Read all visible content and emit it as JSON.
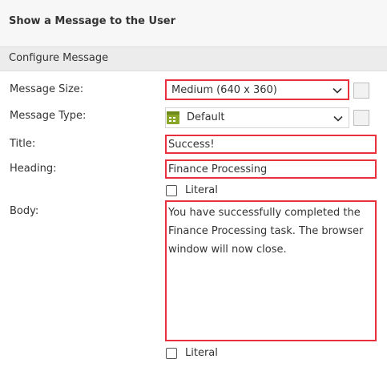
{
  "header": {
    "title": "Show a Message to the User"
  },
  "section": {
    "title": "Configure Message"
  },
  "form": {
    "message_size": {
      "label": "Message Size:",
      "value": "Medium (640 x 360)"
    },
    "message_type": {
      "label": "Message Type:",
      "value": "Default"
    },
    "title": {
      "label": "Title:",
      "value": "Success!"
    },
    "heading": {
      "label": "Heading:",
      "value": "Finance Processing",
      "literal_label": "Literal",
      "literal_checked": false
    },
    "body": {
      "label": "Body:",
      "value": "You have successfully completed the\nFinance Processing task. The browser\nwindow will now close.",
      "literal_label": "Literal",
      "literal_checked": false
    }
  },
  "colors": {
    "highlight_border": "#e8313d",
    "header_bg": "#f7f7f7",
    "section_bg": "#ececec",
    "type_icon": "#8aa629"
  },
  "icons": {
    "dropdown": "chevron-down-icon",
    "message_type": "grid-app-icon",
    "side_button": "expression-toggle-icon"
  }
}
